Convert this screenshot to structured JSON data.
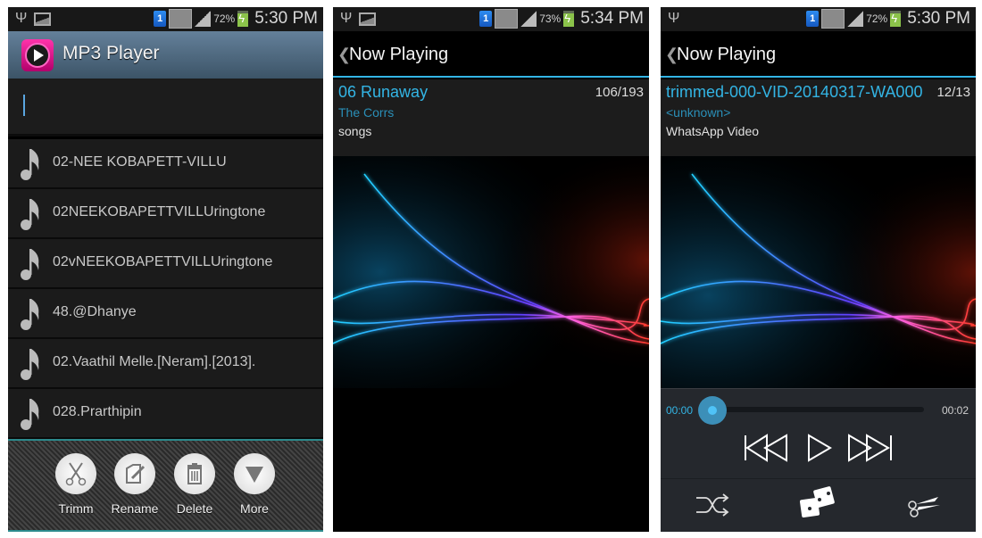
{
  "screens": [
    {
      "status": {
        "battery": "72%",
        "time": "5:30 PM",
        "sim": "1"
      },
      "app_title": "MP3 Player",
      "search": {
        "value": ""
      },
      "songs": [
        "02-NEE KOBAPETT-VILLU",
        "02NEEKOBAPETTVILLUringtone",
        "02vNEEKOBAPETTVILLUringtone",
        "48.@Dhanye",
        "02.Vaathil Melle.[Neram].[2013].",
        "028.Prarthipin"
      ],
      "actions": [
        {
          "label": "Trimm",
          "icon": "scissors-icon"
        },
        {
          "label": "Rename",
          "icon": "edit-icon"
        },
        {
          "label": "Delete",
          "icon": "trash-icon"
        },
        {
          "label": "More",
          "icon": "triangle-down-icon"
        }
      ]
    },
    {
      "status": {
        "battery": "73%",
        "time": "5:34 PM",
        "sim": "1"
      },
      "header": "Now Playing",
      "track": {
        "title": "06 Runaway",
        "count": "106/193",
        "artist": "The Corrs",
        "album": "songs"
      }
    },
    {
      "status": {
        "battery": "72%",
        "time": "5:30 PM",
        "sim": "1"
      },
      "header": "Now Playing",
      "track": {
        "title": "trimmed-000-VID-20140317-WA000",
        "count": "12/13",
        "artist": "<unknown>",
        "album": "WhatsApp Video"
      },
      "player": {
        "elapsed": "00:00",
        "duration": "00:02",
        "progress_fraction": 0.0
      },
      "controls": [
        "previous",
        "play",
        "next"
      ],
      "extras": [
        "shuffle",
        "random",
        "trim"
      ]
    }
  ],
  "colors": {
    "accent": "#33b5e5",
    "toolbar_border": "#2c8a8c",
    "header_blue": "#4e6a80"
  }
}
